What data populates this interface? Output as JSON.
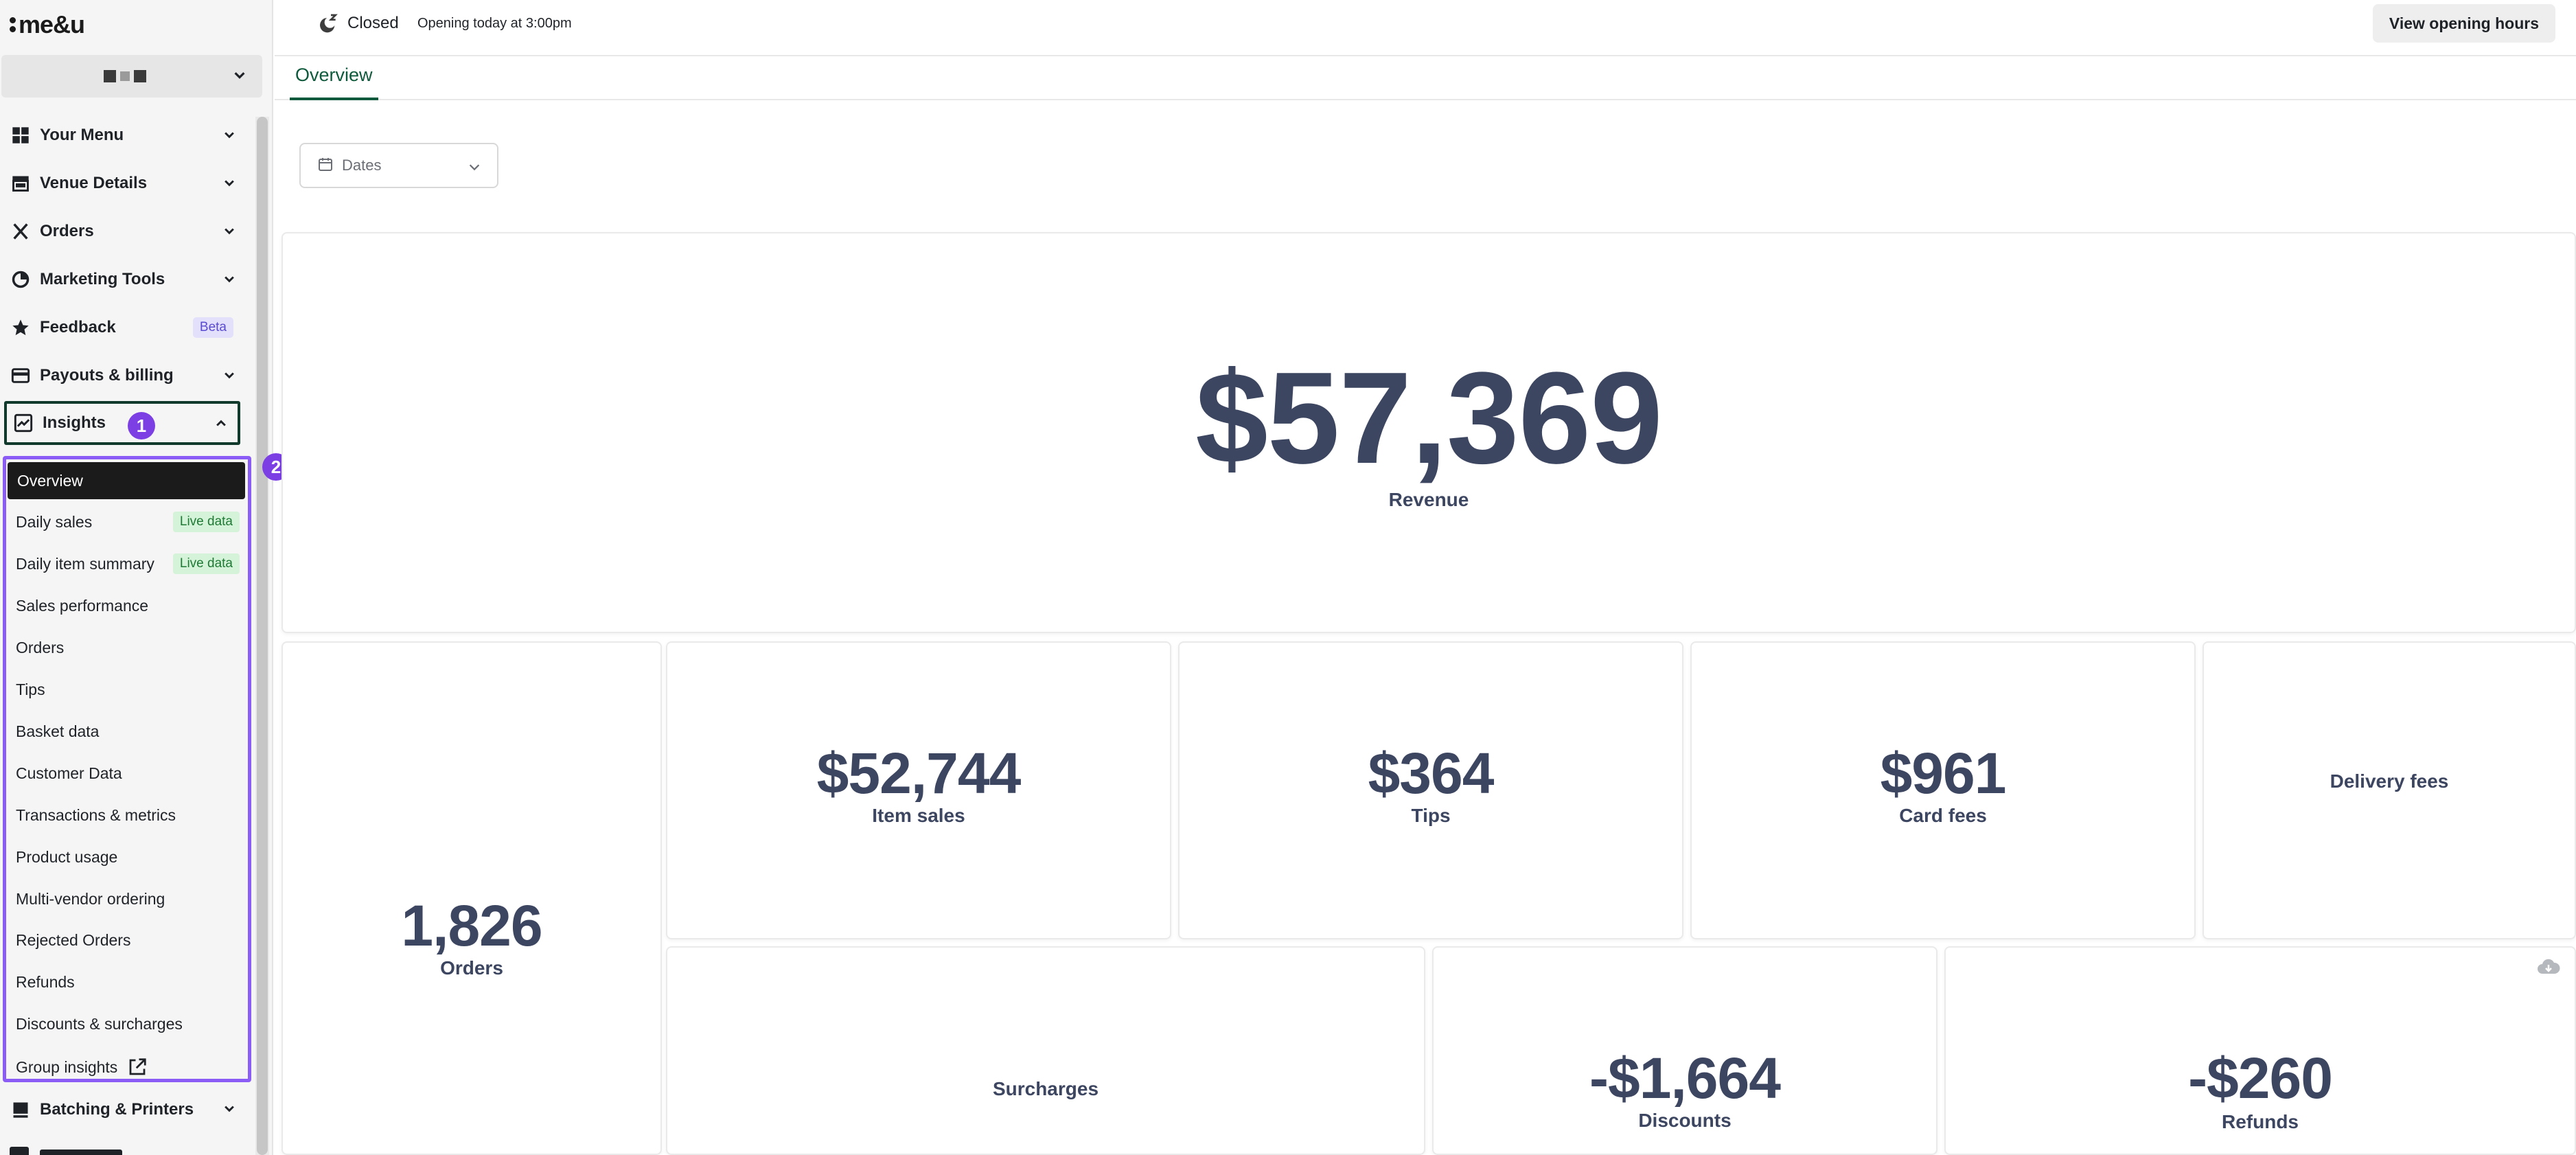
{
  "app": {
    "brand": "me&u"
  },
  "venue": {
    "name_redacted": true
  },
  "sidebar": {
    "items": [
      {
        "label": "Your Menu",
        "icon": "grid-icon"
      },
      {
        "label": "Venue Details",
        "icon": "storefront-icon"
      },
      {
        "label": "Orders",
        "icon": "utensils-icon"
      },
      {
        "label": "Marketing Tools",
        "icon": "pie-chart-icon"
      },
      {
        "label": "Feedback",
        "icon": "star-icon",
        "badge": "Beta"
      },
      {
        "label": "Payouts & billing",
        "icon": "card-icon"
      }
    ],
    "insights": {
      "label": "Insights",
      "marker": "1"
    },
    "subnav_marker": "2",
    "subnav": [
      {
        "label": "Overview",
        "active": true
      },
      {
        "label": "Daily sales",
        "badge": "Live data"
      },
      {
        "label": "Daily item summary",
        "badge": "Live data"
      },
      {
        "label": "Sales performance"
      },
      {
        "label": "Orders"
      },
      {
        "label": "Tips"
      },
      {
        "label": "Basket data"
      },
      {
        "label": "Customer Data"
      },
      {
        "label": "Transactions & metrics"
      },
      {
        "label": "Product usage"
      },
      {
        "label": "Multi-vendor ordering"
      },
      {
        "label": "Rejected Orders"
      },
      {
        "label": "Refunds"
      },
      {
        "label": "Discounts & surcharges"
      },
      {
        "label": "Group insights"
      }
    ],
    "batching": {
      "label": "Batching & Printers"
    }
  },
  "topbar": {
    "status": "Closed",
    "opening": "Opening today at 3:00pm",
    "hours_button": "View opening hours"
  },
  "tabs": {
    "overview": "Overview"
  },
  "filters": {
    "dates_placeholder": "Dates"
  },
  "metrics": {
    "revenue": {
      "value": "$57,369",
      "label": "Revenue"
    },
    "orders": {
      "value": "1,826",
      "label": "Orders"
    },
    "item_sales": {
      "value": "$52,744",
      "label": "Item sales"
    },
    "tips": {
      "value": "$364",
      "label": "Tips"
    },
    "card_fees": {
      "value": "$961",
      "label": "Card fees"
    },
    "delivery_fees": {
      "label": "Delivery fees"
    },
    "surcharges": {
      "label": "Surcharges"
    },
    "discounts": {
      "value": "-$1,664",
      "label": "Discounts"
    },
    "refunds": {
      "value": "-$260",
      "label": "Refunds"
    }
  },
  "colors": {
    "accent_green": "#0f5a3c",
    "highlight_purple": "#8b5cf6",
    "marker_purple": "#7b3fe4",
    "metric_text": "#3d4660"
  }
}
